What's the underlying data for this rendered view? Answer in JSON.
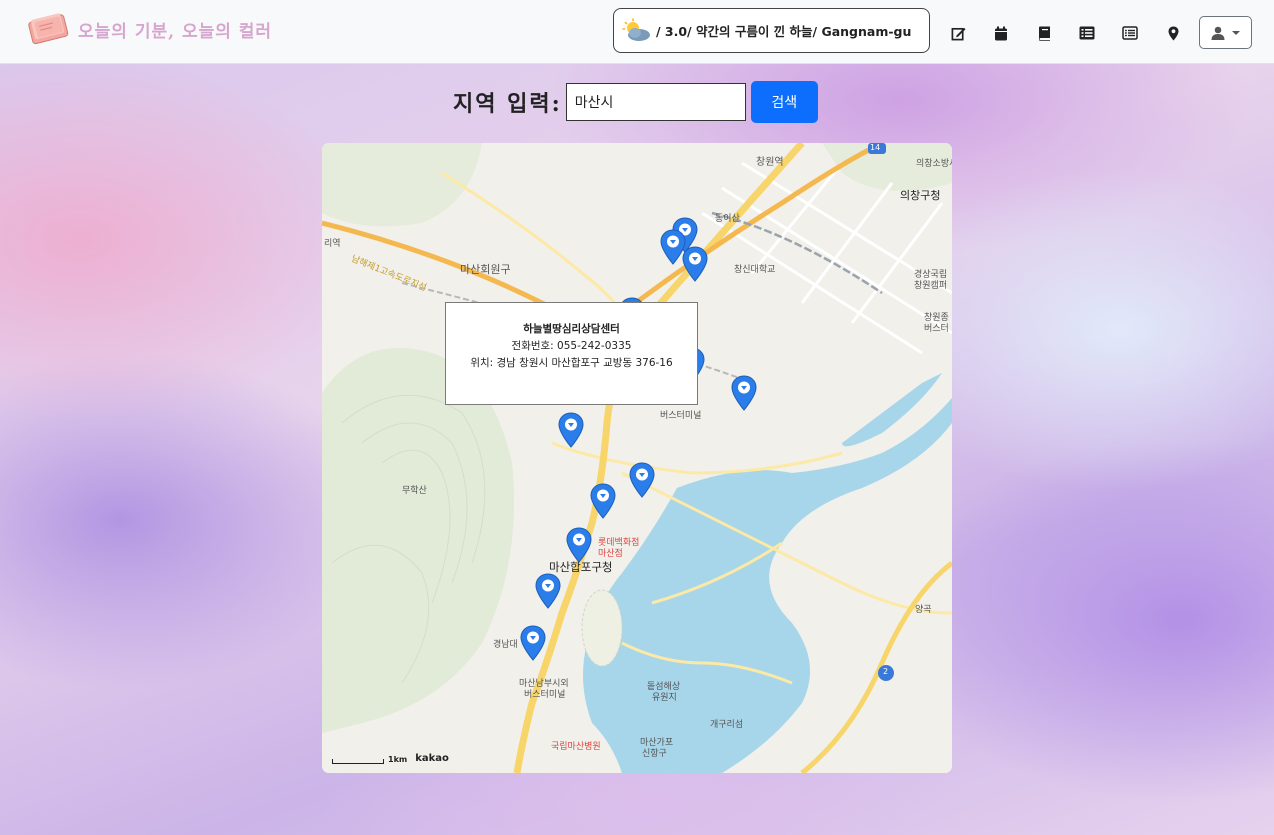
{
  "brand": {
    "title": "오늘의 기분, 오늘의 컬러"
  },
  "weather": {
    "text": "/ 3.0/ 약간의 구름이 낀 하늘/ Gangnam-gu"
  },
  "nav": {
    "icons": [
      "edit-icon",
      "calendar-icon",
      "book-icon",
      "list-icon",
      "list-alt-icon",
      "map-marker-icon"
    ],
    "user_menu": "user-icon"
  },
  "search": {
    "label": "지역 입력:",
    "value": "마산시",
    "button": "검색"
  },
  "map": {
    "labels": {
      "changwon_station": "창원역",
      "dongeup": "동이산",
      "uichang_gu": "의창구청",
      "uichang_fire": "의창소방서",
      "masan_hoewon": "마산회원구",
      "changsin": "창신대학교",
      "gyeongsang": "경상국립",
      "gyeongsang2": "창원캠퍼",
      "changwon_bus": "창원종",
      "changwon_bus2": "버스터",
      "masan_station": "마산역",
      "bus_terminal": "버스터미널",
      "muhaksan": "무학산",
      "lotte": "롯데백화점",
      "lotte2": "마산점",
      "happo_gu": "마산합포구청",
      "kyungnam": "경남대",
      "masan_nambu": "마산남부시외",
      "masan_nambu2": "버스터미널",
      "dotseom": "돝섬해상",
      "dotseom2": "유원지",
      "gaegu": "개구리섬",
      "hospital": "국립마산병원",
      "gapo": "마산가포",
      "gapo2": "신항구",
      "yanggok": "양곡",
      "highway": "남해제1고속도로지선",
      "yeok": "리역",
      "hoewongu_office": "마산회원구청",
      "route14": "14",
      "route2": "2"
    },
    "infowindow": {
      "title": "하늘별땅심리상담센터",
      "phone": "전화번호: 055-242-0335",
      "address": "위치: 경남 창원시 마산합포구 교방동 376-16"
    },
    "scale": "1km",
    "logo": "kakao",
    "marker_count": 13
  },
  "colors": {
    "primary": "#0d6efd",
    "marker": "#2b7de9",
    "water": "#a7d6ea",
    "road": "#f7d56a",
    "brand_text": "#d7a6cf"
  }
}
